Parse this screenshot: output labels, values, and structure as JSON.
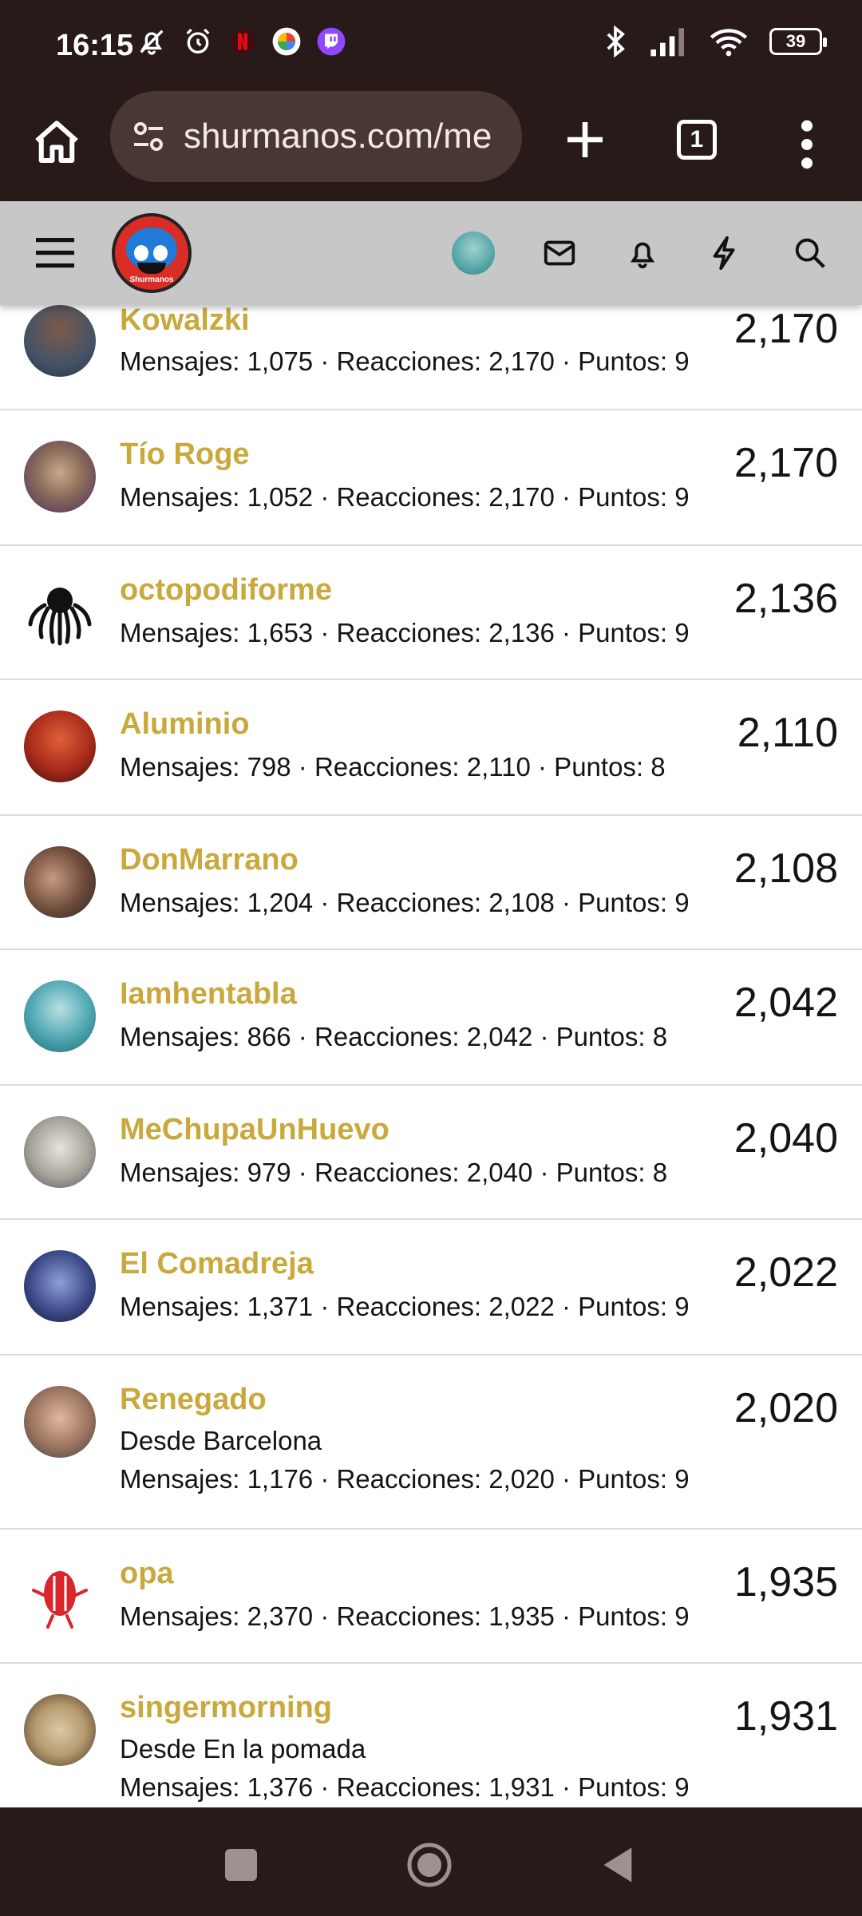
{
  "status_bar": {
    "time": "16:15",
    "battery": "39",
    "left_icons": [
      "mute-bell-icon",
      "alarm-icon",
      "netflix-icon",
      "photos-icon",
      "twitch-icon"
    ],
    "right_icons": [
      "bluetooth-icon",
      "signal-icon",
      "wifi-icon",
      "battery-icon"
    ]
  },
  "browser": {
    "url": "shurmanos.com/me",
    "tab_count": "1",
    "icons": [
      "home-icon",
      "site-settings-icon",
      "new-tab-icon",
      "tab-switcher-icon",
      "more-menu-icon"
    ]
  },
  "site_header": {
    "logo_text": "Shurmanos",
    "icons": [
      "menu-icon",
      "avatar",
      "mail-icon",
      "bell-icon",
      "lightning-icon",
      "search-icon"
    ]
  },
  "members": [
    {
      "name": "Kowalzki",
      "location": "",
      "stats": "Mensajes: 1,075 · Reacciones: 2,170 · Puntos: 9",
      "score": "2,170"
    },
    {
      "name": "Tío Roge",
      "location": "",
      "stats": "Mensajes: 1,052 · Reacciones: 2,170 · Puntos: 9",
      "score": "2,170"
    },
    {
      "name": "octopodiforme",
      "location": "",
      "stats": "Mensajes: 1,653 · Reacciones: 2,136 · Puntos: 9",
      "score": "2,136"
    },
    {
      "name": "Aluminio",
      "location": "",
      "stats": "Mensajes: 798 · Reacciones: 2,110 · Puntos: 8",
      "score": "2,110"
    },
    {
      "name": "DonMarrano",
      "location": "",
      "stats": "Mensajes: 1,204 · Reacciones: 2,108 · Puntos: 9",
      "score": "2,108"
    },
    {
      "name": "Iamhentabla",
      "location": "",
      "stats": "Mensajes: 866 · Reacciones: 2,042 · Puntos: 8",
      "score": "2,042"
    },
    {
      "name": "MeChupaUnHuevo",
      "location": "",
      "stats": "Mensajes: 979 · Reacciones: 2,040 · Puntos: 8",
      "score": "2,040"
    },
    {
      "name": "El Comadreja",
      "location": "",
      "stats": "Mensajes: 1,371 · Reacciones: 2,022 · Puntos: 9",
      "score": "2,022"
    },
    {
      "name": "Renegado",
      "location": "Desde Barcelona",
      "stats": "Mensajes: 1,176 · Reacciones: 2,020 · Puntos: 9",
      "score": "2,020"
    },
    {
      "name": "opa",
      "location": "",
      "stats": "Mensajes: 2,370 · Reacciones: 1,935 · Puntos: 9",
      "score": "1,935"
    },
    {
      "name": "singermorning",
      "location": "Desde En la pomada",
      "stats": "Mensajes: 1,376 · Reacciones: 1,931 · Puntos: 9",
      "score": "1,931"
    }
  ],
  "nav_bar": {
    "icons": [
      "recents-icon",
      "home-circle-icon",
      "back-icon"
    ]
  }
}
